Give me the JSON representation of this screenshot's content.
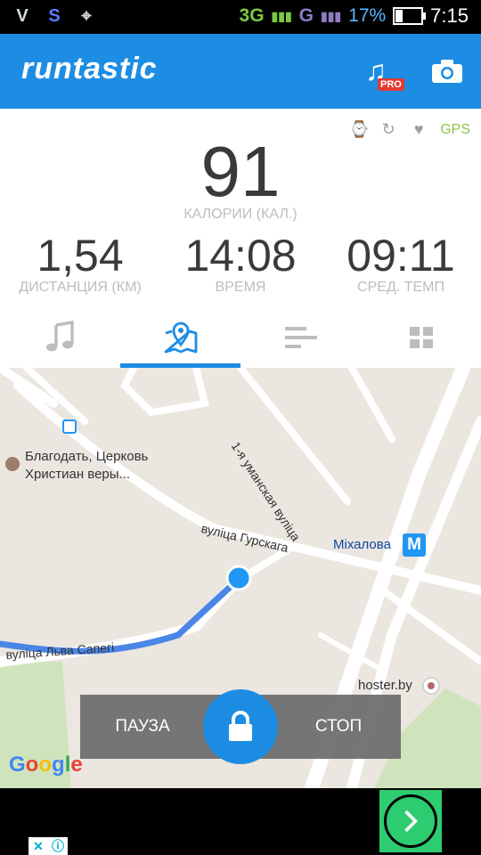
{
  "status_bar": {
    "left_icons": [
      "usb-debug-icon",
      "sync-icon",
      "location-icon"
    ],
    "network_1": "3G",
    "network_2": "G",
    "battery": "17%",
    "battery_level": 0.17,
    "time": "7:15"
  },
  "app_bar": {
    "logo": "runtastic",
    "pro_badge": "PRO",
    "icons": [
      "music-pro-icon",
      "camera-icon"
    ]
  },
  "sensors": {
    "icons": [
      "watch-icon",
      "power-song-icon",
      "heart-icon"
    ],
    "gps": "GPS"
  },
  "stats": {
    "calories": {
      "value": "91",
      "label": "КАЛОРИИ (КАЛ.)"
    },
    "distance": {
      "value": "1,54",
      "label": "ДИСТАНЦИЯ (КМ)"
    },
    "time": {
      "value": "14:08",
      "label": "ВРЕМЯ"
    },
    "pace": {
      "value": "09:11",
      "label": "СРЕД. ТЕМП"
    }
  },
  "tabs": [
    {
      "name": "music",
      "icon": "music-note-icon"
    },
    {
      "name": "map",
      "icon": "map-pin-icon",
      "active": true
    },
    {
      "name": "stats",
      "icon": "bars-icon"
    },
    {
      "name": "dashboard",
      "icon": "grid-icon"
    }
  ],
  "map": {
    "poi_church": "Благодать, Церковь\nХристиан веры...",
    "street_1": "1-я уманская вуліца",
    "street_2": "вуліца Гурскага",
    "street_3": "вуліца Льва Сапегі",
    "metro": "Міхалова",
    "metro_badge": "M",
    "poi_hoster": "hoster.by",
    "google": "Google"
  },
  "controls": {
    "pause": "ПАУЗА",
    "stop": "СТОП"
  },
  "colors": {
    "brand": "#1d8de3",
    "stat_text": "#3a3a3a",
    "label_text": "#bdbdbd",
    "route": "#4a86e8",
    "gps": "#8bc34a"
  }
}
